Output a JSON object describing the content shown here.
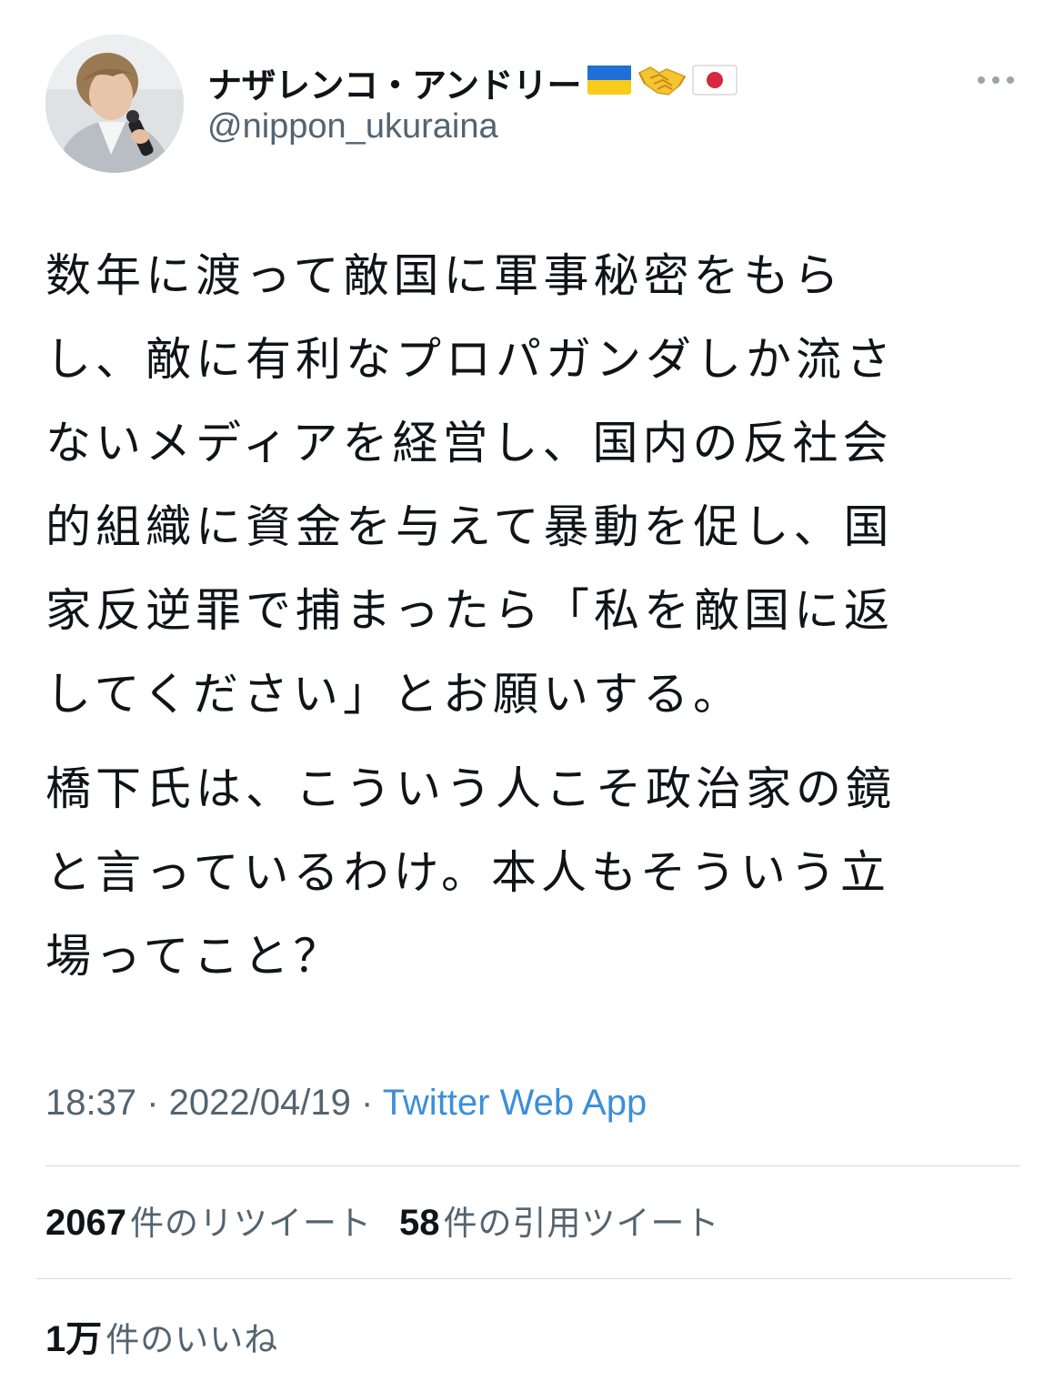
{
  "user": {
    "display_name": "ナザレンコ・アンドリー",
    "handle": "@nippon_ukuraina",
    "emoji_icons": [
      "ukraine-flag-icon",
      "handshake-icon",
      "japan-flag-icon"
    ]
  },
  "tweet": {
    "paragraphs": [
      [
        "数年に渡って敵国に軍事秘密をもら",
        "し、敵に有利なプロパガンダしか流さ",
        "ないメディアを経営し、国内の反社会",
        "的組織に資金を与えて暴動を促し、国",
        "家反逆罪で捕まったら「私を敵国に返",
        "してください」とお願いする。"
      ],
      [
        "橋下氏は、こういう人こそ政治家の鏡",
        "と言っているわけ。本人もそういう立",
        "場ってこと？"
      ]
    ]
  },
  "meta": {
    "time": "18:37",
    "separator": " · ",
    "date": "2022/04/19",
    "source": "Twitter Web App"
  },
  "stats": {
    "retweets_count": "2067",
    "retweets_label": "件のリツイート",
    "quotes_count": "58",
    "quotes_label": "件の引用ツイート",
    "likes_count": "1万",
    "likes_label": "件のいいね"
  },
  "colors": {
    "text_primary": "#0f1419",
    "text_secondary": "#536471",
    "link": "#3b8fd9",
    "divider": "#d7dadd"
  }
}
